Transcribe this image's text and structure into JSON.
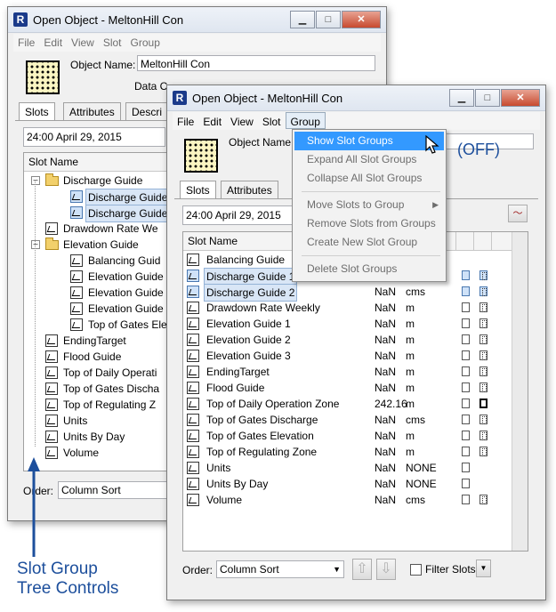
{
  "back_window": {
    "title": "Open Object - MeltonHill Con",
    "menu": [
      "File",
      "Edit",
      "View",
      "Slot",
      "Group"
    ],
    "object_name_label": "Object Name:",
    "object_name_value": "MeltonHill Con",
    "data_label": "Data C",
    "tabs": [
      "Slots",
      "Attributes",
      "Descri"
    ],
    "date": "24:00 April 29, 2015",
    "column_header": "Slot Name",
    "tree": [
      {
        "label": "Discharge Guide",
        "type": "group",
        "indent": 0,
        "expander": "-"
      },
      {
        "label": "Discharge Guide",
        "type": "slot",
        "indent": 1,
        "selected": true
      },
      {
        "label": "Discharge Guide",
        "type": "slot",
        "indent": 1,
        "selected": true
      },
      {
        "label": "Drawdown Rate We",
        "type": "slot",
        "indent": 0
      },
      {
        "label": "Elevation Guide",
        "type": "group",
        "indent": 0,
        "expander": "-"
      },
      {
        "label": "Balancing Guid",
        "type": "slot",
        "indent": 1
      },
      {
        "label": "Elevation Guide",
        "type": "slot",
        "indent": 1
      },
      {
        "label": "Elevation Guide",
        "type": "slot",
        "indent": 1
      },
      {
        "label": "Elevation Guide",
        "type": "slot",
        "indent": 1
      },
      {
        "label": "Top of Gates Elev",
        "type": "slot",
        "indent": 1
      },
      {
        "label": "EndingTarget",
        "type": "slot",
        "indent": 0
      },
      {
        "label": "Flood Guide",
        "type": "slot",
        "indent": 0
      },
      {
        "label": "Top of Daily Operati",
        "type": "slot",
        "indent": 0
      },
      {
        "label": "Top of Gates Discha",
        "type": "slot",
        "indent": 0
      },
      {
        "label": "Top of Regulating Z",
        "type": "slot",
        "indent": 0
      },
      {
        "label": "Units",
        "type": "slot",
        "indent": 0
      },
      {
        "label": "Units By Day",
        "type": "slot",
        "indent": 0
      },
      {
        "label": "Volume",
        "type": "slot",
        "indent": 0
      }
    ],
    "order_label": "Order:",
    "order_value": "Column Sort"
  },
  "front_window": {
    "title": "Open Object - MeltonHill Con",
    "menu": [
      "File",
      "Edit",
      "View",
      "Slot",
      "Group"
    ],
    "object_name_label": "Object Name:",
    "status_text": "(OFF)",
    "tabs": [
      "Slots",
      "Attributes"
    ],
    "date": "24:00 April 29, 2015",
    "column_header": "Slot Name",
    "rows": [
      {
        "name": "Balancing Guide",
        "value": "",
        "unit": "",
        "boxes": ""
      },
      {
        "name": "Discharge Guide 1",
        "value": "",
        "unit": "",
        "boxes": "blue",
        "selected": true
      },
      {
        "name": "Discharge Guide 2",
        "value": "NaN",
        "unit": "cms",
        "boxes": "blue",
        "selected": true
      },
      {
        "name": "Drawdown Rate Weekly",
        "value": "NaN",
        "unit": "m",
        "boxes": "both"
      },
      {
        "name": "Elevation Guide 1",
        "value": "NaN",
        "unit": "m",
        "boxes": "both"
      },
      {
        "name": "Elevation Guide 2",
        "value": "NaN",
        "unit": "m",
        "boxes": "both"
      },
      {
        "name": "Elevation Guide 3",
        "value": "NaN",
        "unit": "m",
        "boxes": "both"
      },
      {
        "name": "EndingTarget",
        "value": "NaN",
        "unit": "m",
        "boxes": "both"
      },
      {
        "name": "Flood Guide",
        "value": "NaN",
        "unit": "m",
        "boxes": "both"
      },
      {
        "name": "Top of Daily Operation Zone",
        "value": "242.16",
        "unit": "m",
        "boxes": "heavy"
      },
      {
        "name": "Top of Gates Discharge",
        "value": "NaN",
        "unit": "cms",
        "boxes": "both"
      },
      {
        "name": "Top of Gates Elevation",
        "value": "NaN",
        "unit": "m",
        "boxes": "both"
      },
      {
        "name": "Top of Regulating Zone",
        "value": "NaN",
        "unit": "m",
        "boxes": "both"
      },
      {
        "name": "Units",
        "value": "NaN",
        "unit": "NONE",
        "boxes": "one"
      },
      {
        "name": "Units By Day",
        "value": "NaN",
        "unit": "NONE",
        "boxes": "one"
      },
      {
        "name": "Volume",
        "value": "NaN",
        "unit": "cms",
        "boxes": "both"
      }
    ],
    "order_label": "Order:",
    "order_value": "Column Sort",
    "filter_label": "Filter Slots"
  },
  "group_menu": {
    "items": [
      {
        "label": "Show Slot Groups",
        "highlighted": true
      },
      {
        "label": "Expand All Slot Groups"
      },
      {
        "label": "Collapse All Slot Groups"
      },
      {
        "separator": true
      },
      {
        "label": "Move Slots to Group",
        "submenu": true
      },
      {
        "label": "Remove Slots from Groups"
      },
      {
        "label": "Create New Slot Group"
      },
      {
        "separator": true
      },
      {
        "label": "Delete Slot Groups"
      }
    ]
  },
  "annotation": {
    "line1": "Slot Group",
    "line2": "Tree Controls",
    "color": "#1d4f9c"
  }
}
